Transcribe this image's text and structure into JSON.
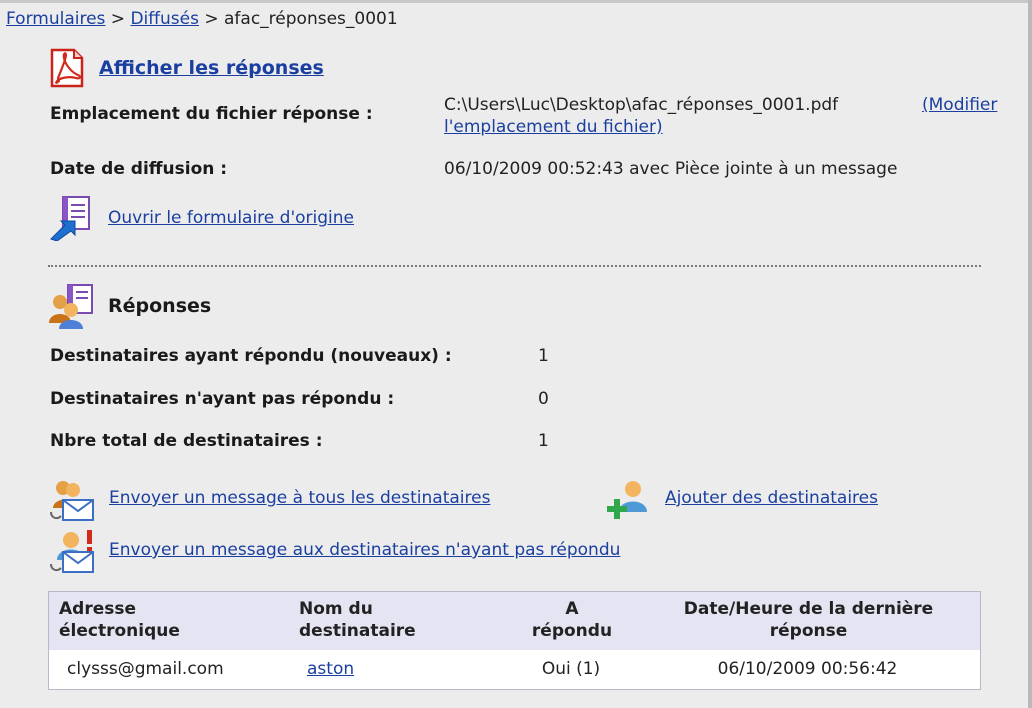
{
  "breadcrumb": {
    "item1": "Formulaires",
    "sep1": " > ",
    "item2": "Diffusés",
    "sep2": " > ",
    "current": "afac_réponses_0001"
  },
  "header": {
    "title": "Afficher les réponses"
  },
  "info": {
    "location_label": "Emplacement du fichier réponse :",
    "location_path": "C:\\Users\\Luc\\Desktop\\afac_réponses_0001.pdf",
    "modify_link_1": "(Modifier",
    "modify_link_2": "l'emplacement du fichier)",
    "date_label": "Date de diffusion :",
    "date_value": "06/10/2009 00:52:43 avec Pièce jointe à un message",
    "open_form_link": "Ouvrir le formulaire d'origine"
  },
  "responses": {
    "title": "Réponses",
    "stats": [
      {
        "label": "Destinataires ayant répondu (nouveaux) :",
        "value": "1"
      },
      {
        "label": "Destinataires n'ayant pas répondu :",
        "value": "0"
      },
      {
        "label": "Nbre total de destinataires :",
        "value": "1"
      }
    ],
    "actions": {
      "send_all": "Envoyer un message à tous les destinataires",
      "add_recipients": "Ajouter des destinataires",
      "send_unanswered": "Envoyer un message aux destinataires n'ayant pas répondu"
    }
  },
  "table": {
    "headers": [
      {
        "line1": "Adresse",
        "line2": "électronique"
      },
      {
        "line1": "Nom du",
        "line2": "destinataire"
      },
      {
        "line1": "A",
        "line2": "répondu"
      },
      {
        "line1": "Date/Heure de la dernière",
        "line2": "réponse"
      }
    ],
    "rows": [
      {
        "email": "clysss@gmail.com",
        "name": "aston",
        "answered": "Oui (1)",
        "last": "06/10/2009 00:56:42"
      }
    ]
  },
  "colors": {
    "link": "#1a3fa0",
    "background": "#ececec",
    "table_header": "#e4e4f2",
    "pdf_red": "#d42a1e"
  }
}
